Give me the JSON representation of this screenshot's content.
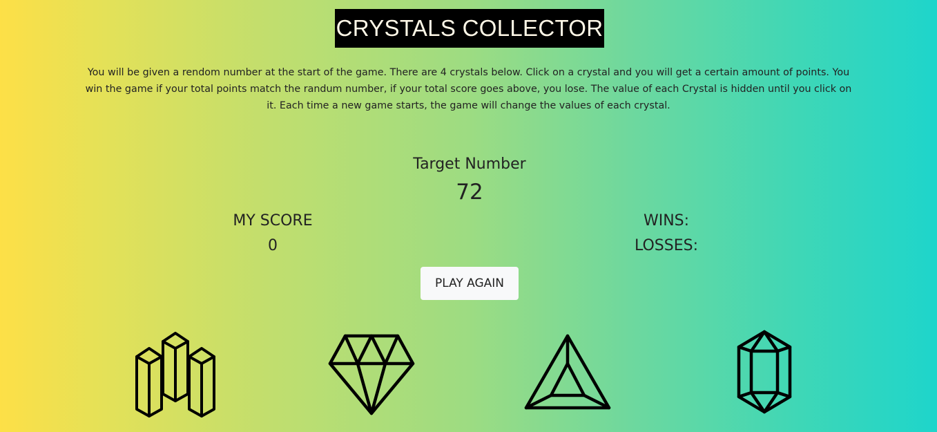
{
  "header": {
    "title": "CRYSTALS COLLECTOR"
  },
  "instructions": "You will be given a rendom number at the start of the game. There are 4 crystals below. Click on a crystal and you will get a certain amount of points. You win the game if your total points match the randum number, if your total score goes above, you lose. The value of each Crystal is hidden until you click on it. Each time a new game starts, the game will change the values of each crystal.",
  "target": {
    "label": "Target Number",
    "value": "72"
  },
  "score": {
    "label": "MY SCORE",
    "value": "0"
  },
  "stats": {
    "wins_label": "WINS:",
    "losses_label": "LOSSES:"
  },
  "buttons": {
    "play_again": "PLAY AGAIN"
  },
  "crystals": [
    {
      "icon": "crystal-cluster-icon"
    },
    {
      "icon": "diamond-icon"
    },
    {
      "icon": "triangle-gem-icon"
    },
    {
      "icon": "hexagonal-crystal-icon"
    }
  ],
  "colors": {
    "gradient_left": "#fde047",
    "gradient_right": "#1ed5cb",
    "title_bg": "#000000",
    "title_text": "#fff8e7",
    "button_bg": "#f8f9fa"
  }
}
